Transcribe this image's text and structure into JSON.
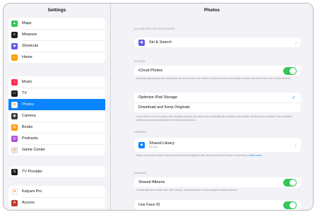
{
  "sidebar": {
    "title": "Settings",
    "group1": [
      {
        "label": "Maps",
        "icon": "maps-icon",
        "color": "#34c759",
        "glyph": "▲"
      },
      {
        "label": "Measure",
        "icon": "measure-icon",
        "color": "#1c1c1e",
        "glyph": "≡"
      },
      {
        "label": "Shortcuts",
        "icon": "shortcuts-icon",
        "color": "#5e5ce6",
        "glyph": "◆"
      },
      {
        "label": "Home",
        "icon": "home-icon",
        "color": "#ff9f0a",
        "glyph": "⌂"
      }
    ],
    "group2": [
      {
        "label": "Music",
        "icon": "music-icon",
        "color": "#ff2d55",
        "glyph": "♪"
      },
      {
        "label": "TV",
        "icon": "tv-icon",
        "color": "#1c1c1e",
        "glyph": "▭"
      },
      {
        "label": "Photos",
        "icon": "photos-icon",
        "color": "#ffffff",
        "glyph": "✿",
        "selected": true
      },
      {
        "label": "Camera",
        "icon": "camera-icon",
        "color": "#3a3a3c",
        "glyph": "◉"
      },
      {
        "label": "Books",
        "icon": "books-icon",
        "color": "#ff9500",
        "glyph": "▤"
      },
      {
        "label": "Podcasts",
        "icon": "podcasts-icon",
        "color": "#af52de",
        "glyph": "◎"
      },
      {
        "label": "Game Center",
        "icon": "game-center-icon",
        "color": "#e5e5ea",
        "glyph": "●"
      }
    ],
    "group3": [
      {
        "label": "TV Provider",
        "icon": "tv-provider-icon",
        "color": "#1c1c1e",
        "glyph": "S"
      }
    ],
    "group4": [
      {
        "label": "Kalyani Pro",
        "icon": "app-icon",
        "color": "#ffffff",
        "glyph": "✿"
      },
      {
        "label": "Access",
        "icon": "access-icon",
        "color": "#c0392b",
        "glyph": "A"
      }
    ]
  },
  "main": {
    "title": "Photos",
    "section_siri": "ALLOW PHOTOS TO ACCESS",
    "siri_label": "Siri & Search",
    "section_icloud": "ICLOUD",
    "icloud_label": "iCloud Photos",
    "icloud_note": "Automatically upload and safely store all your photos and videos in iCloud so you can browse, search and share from any of your devices.",
    "optimize_label": "Optimize iPad Storage",
    "download_label": "Download and Keep Originals",
    "storage_note": "If your iPad is low on space, full-resolution photos and videos are automatically replaced with smaller, device-sized versions. Full-resolution versions can be downloaded from iCloud at any time.",
    "section_library": "LIBRARY",
    "library_label": "Shared Library",
    "library_sub": "Set Up",
    "library_note": "Share photos and videos from moments shared together with family and close friends in one library.",
    "library_link": "Learn more...",
    "section_albums": "ALBUMS",
    "albums_label": "Shared Albums",
    "albums_note": "Create albums to share with other people, and subscribe to other people's shared albums.",
    "faceid_label": "Use Face ID",
    "toggle_on_color": "#34c759",
    "accent_color": "#0a84ff"
  }
}
